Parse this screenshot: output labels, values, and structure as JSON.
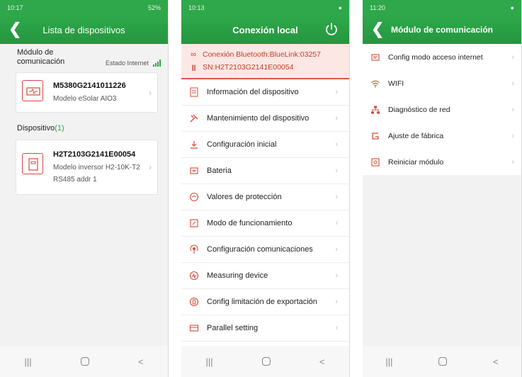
{
  "colors": {
    "accent": "#2ea84a",
    "icon_red": "#d44a3a",
    "connection_text": "#c73a2a"
  },
  "screen1": {
    "status": {
      "time": "10:17",
      "battery": "52%"
    },
    "title": "Lista de dispositivos",
    "module_section": {
      "label": "Módulo de comunicación",
      "internet_status": "Estado Internet"
    },
    "module_card": {
      "serial": "M5380G2141011226",
      "model": "Modelo eSolar AIO3"
    },
    "device_section": {
      "label": "Dispositivo",
      "count": "(1)"
    },
    "device_card": {
      "serial": "H2T2103G2141E00054",
      "model": "Modelo inversor  H2-10K-T2",
      "addr": "RS485 addr  1"
    }
  },
  "screen2": {
    "status": {
      "time": "10:13"
    },
    "title": "Conexión local",
    "connection": {
      "bluetooth": "Conexión Bluetooth:BlueLink:03257",
      "sn": "SN:H2T2103G2141E00054"
    },
    "menu": [
      {
        "label": "Información del dispositivo",
        "icon": "info-doc-icon"
      },
      {
        "label": "Mantenimiento del dispositivo",
        "icon": "tools-icon"
      },
      {
        "label": "Configuración inicial",
        "icon": "initial-setup-icon"
      },
      {
        "label": "Bateria",
        "icon": "battery-icon"
      },
      {
        "label": "Valores de protección",
        "icon": "protection-icon"
      },
      {
        "label": "Modo de funcionamiento",
        "icon": "mode-icon"
      },
      {
        "label": "Configuración comunicaciones",
        "icon": "communication-icon"
      },
      {
        "label": "Measuring device",
        "icon": "meter-icon"
      },
      {
        "label": "Config limitación de exportación",
        "icon": "export-limit-icon"
      },
      {
        "label": "Parallel setting",
        "icon": "parallel-icon"
      }
    ]
  },
  "screen3": {
    "status": {
      "time": "11:20"
    },
    "title": "Módulo de comunicación",
    "menu": [
      {
        "label": "Config modo acceso internet",
        "icon": "internet-access-icon"
      },
      {
        "label": "WIFI",
        "icon": "wifi-icon"
      },
      {
        "label": "Diagnóstico de red",
        "icon": "network-icon"
      },
      {
        "label": "Ajuste de fábrica",
        "icon": "factory-reset-icon"
      },
      {
        "label": "Reiniciar módulo",
        "icon": "restart-icon"
      }
    ]
  },
  "navbar": {
    "recent": "|||",
    "back": "<"
  }
}
